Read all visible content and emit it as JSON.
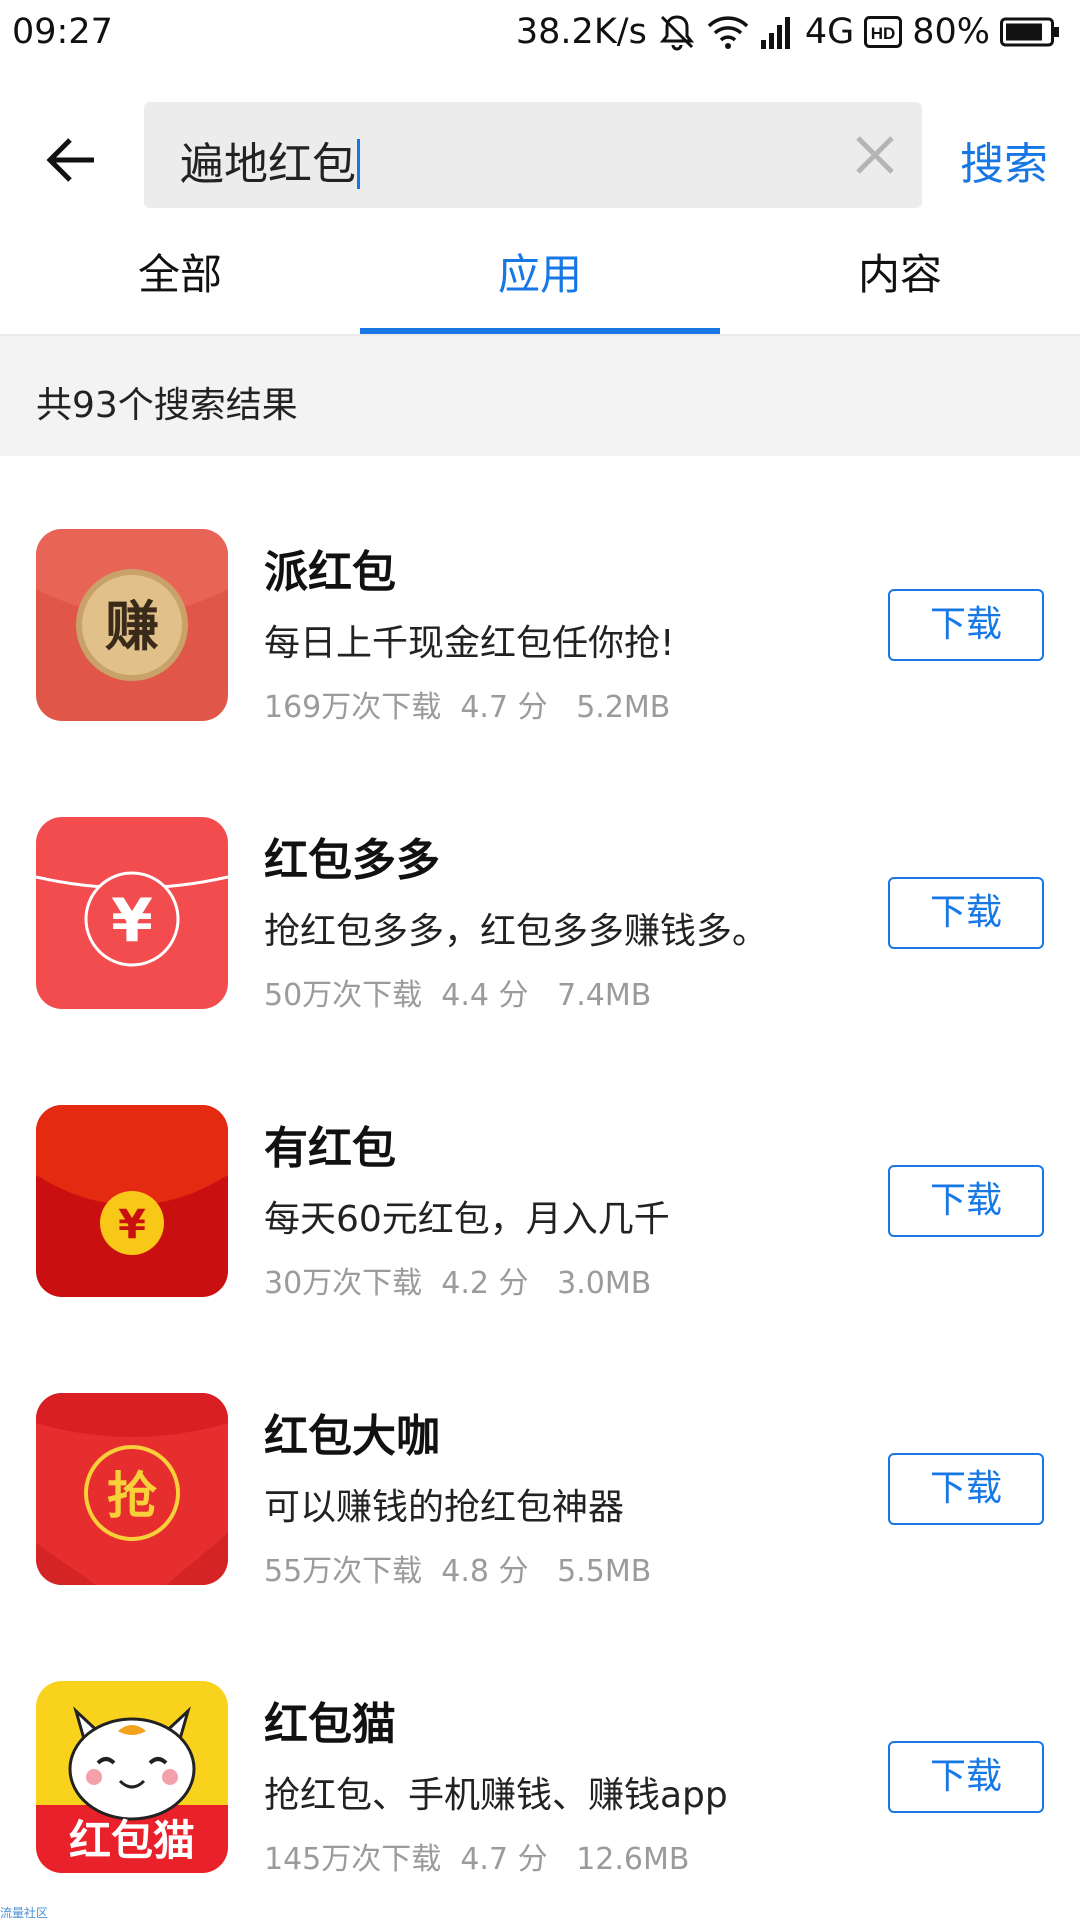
{
  "status_bar": {
    "time": "09:27",
    "net_speed": "38.2K/s",
    "network": "4G",
    "battery": "80%",
    "icons": [
      "bell-off-icon",
      "wifi-icon",
      "signal-icon",
      "hd-icon",
      "battery-icon"
    ]
  },
  "search": {
    "query": "遍地红包",
    "search_label": "搜索"
  },
  "tabs": [
    {
      "label": "全部",
      "active": false
    },
    {
      "label": "应用",
      "active": true
    },
    {
      "label": "内容",
      "active": false
    }
  ],
  "result_count": "共93个搜索结果",
  "colors": {
    "accent": "#1677e5",
    "meta_text": "#9b9b9b",
    "band_bg": "#f3f3f3"
  },
  "apps": [
    {
      "name": "派红包",
      "desc": "每日上千现金红包任你抢!",
      "downloads": "169万次下载",
      "rating": "4.7 分",
      "size": "5.2MB",
      "button": "下载",
      "icon_glyph": "赚",
      "icon": "red-envelope-earn-icon"
    },
    {
      "name": "红包多多",
      "desc": "抢红包多多，红包多多赚钱多。",
      "downloads": "50万次下载",
      "rating": "4.4 分",
      "size": "7.4MB",
      "button": "下载",
      "icon_glyph": "¥",
      "icon": "red-envelope-yen-icon"
    },
    {
      "name": "有红包",
      "desc": "每天60元红包，月入几千",
      "downloads": "30万次下载",
      "rating": "4.2 分",
      "size": "3.0MB",
      "button": "下载",
      "icon_glyph": "¥",
      "icon": "red-envelope-gold-coin-icon"
    },
    {
      "name": "红包大咖",
      "desc": "可以赚钱的抢红包神器",
      "downloads": "55万次下载",
      "rating": "4.8 分",
      "size": "5.5MB",
      "button": "下载",
      "icon_glyph": "抢",
      "icon": "red-envelope-grab-icon"
    },
    {
      "name": "红包猫",
      "desc": "抢红包、手机赚钱、赚钱app",
      "downloads": "145万次下载",
      "rating": "4.7 分",
      "size": "12.6MB",
      "button": "下载",
      "icon_glyph": "红包猫",
      "icon": "lucky-cat-icon"
    }
  ],
  "watermark": "流量社区"
}
